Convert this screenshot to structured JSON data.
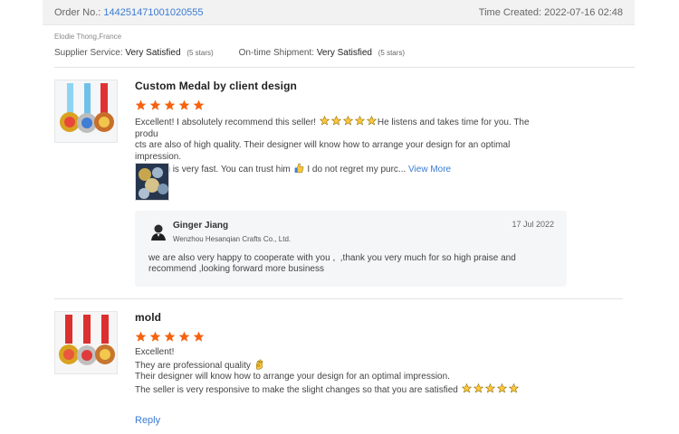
{
  "order": {
    "label": "Order No.:",
    "number": "144251471001020555",
    "time_label": "Time Created:",
    "time_value": "2022-07-16 02:48"
  },
  "buyer": {
    "name": "Elodie Thong,France",
    "supplier_service_label": "Supplier Service:",
    "supplier_service_value": "Very Satisfied",
    "supplier_service_stars": "(5 stars)",
    "shipment_label": "On-time Shipment:",
    "shipment_value": "Very Satisfied",
    "shipment_stars": "(5 stars)"
  },
  "reviews": [
    {
      "product_title": "Custom Medal by client design",
      "rating": 5,
      "text_part1": "Excellent!  I absolutely recommend this seller!",
      "text_part2": "He listens and takes time for you.  The produ",
      "text_line2": "cts are also of high quality. Their designer will know how to arrange your design for an optimal impression.",
      "text_line3a": "Shipping is very fast. You can trust him",
      "text_line3b": "I do not regret my purc...",
      "view_more": "View More",
      "seller_reply": {
        "name": "Ginger Jiang",
        "company": "Wenzhou Hesanqian Crafts Co., Ltd.",
        "date": "17 Jul 2022",
        "text": "we are also very happy to cooperate with you ,  ,thank you very much for so high praise and recommend ,looking forward more business"
      }
    },
    {
      "product_title": "mold",
      "rating": 5,
      "line1": "Excellent!",
      "line2": "They are professional quality",
      "line3": "Their designer will know how to arrange your design for an optimal impression.",
      "line4": "The seller is very responsive to make the slight changes so that you are satisfied",
      "reply_label": "Reply"
    }
  ],
  "colors": {
    "star": "#f5620f",
    "link": "#3a7bd5",
    "emoji_star": "#ffc83d"
  },
  "icons": [
    "star-icon",
    "emoji-star-icon",
    "thumbs-up-emoji-icon",
    "ok-hand-emoji-icon",
    "seller-avatar-icon"
  ]
}
